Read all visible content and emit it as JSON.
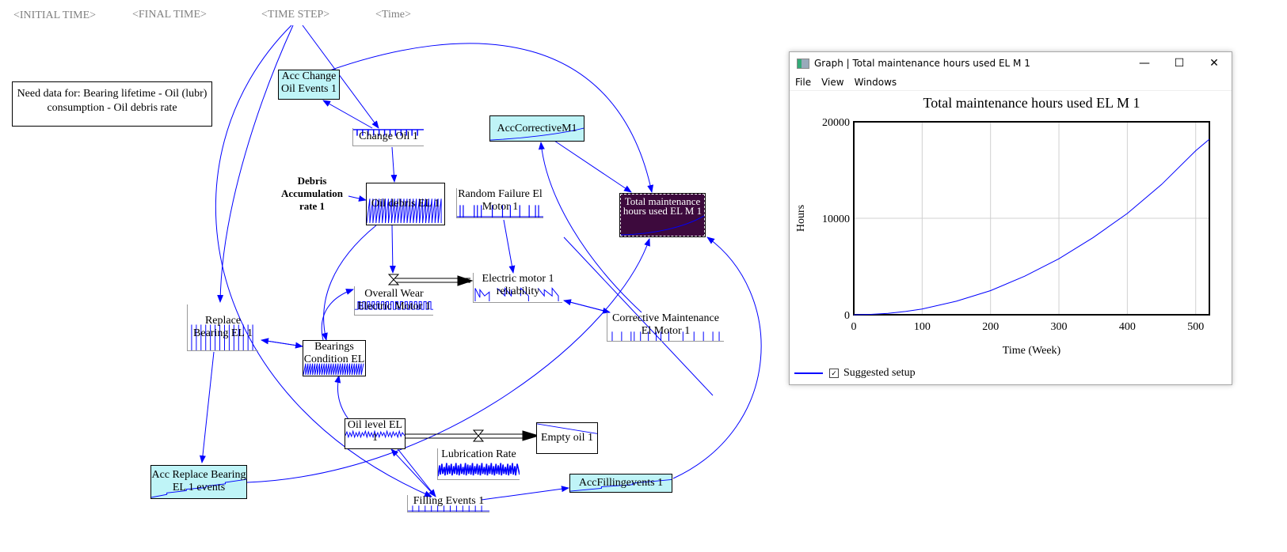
{
  "diagram": {
    "shadow_variables": [
      "<INITIAL TIME>",
      "<FINAL TIME>",
      "<TIME STEP>",
      "<Time>"
    ],
    "note": "Need data for: Bearing lifetime - Oil (lubr) consumption - Oil debris rate",
    "variables": {
      "acc_change_oil_events": "Acc Change Oil Events 1",
      "change_oil": "Change Oil 1",
      "debris_accumulation_rate": "Debris Accumulation rate 1",
      "oil_debris": "Oil debris EL 1",
      "random_failure": "Random Failure El Motor 1",
      "acc_corrective": "AccCorrectiveM1",
      "total_maintenance_hours": "Total maintenance hours used EL M 1",
      "overall_wear": "Overall Wear Electric Motor 1",
      "electric_motor_reliability": "Electric motor 1 reliability",
      "corrective_maintenance": "Corrective Maintenance El Motor 1",
      "replace_bearing": "Replace Bearing EL 1",
      "bearings_condition": "Bearings Condition EL",
      "oil_level": "Oil level EL 1",
      "lubrication_rate": "Lubrication Rate",
      "empty_oil": "Empty oil 1",
      "acc_replace_bearing_events": "Acc Replace Bearing EL 1 events",
      "filling_events": "Filling Events 1",
      "acc_filling_events": "AccFillingevents 1"
    },
    "colors": {
      "link": "#0000ff",
      "stock_cyan": "#bff4f7",
      "selected": "#3d0a3d"
    }
  },
  "graph_window": {
    "title": "Graph | Total maintenance hours used EL M 1",
    "menu": [
      "File",
      "View",
      "Windows"
    ],
    "buttons": {
      "minimize": "—",
      "maximize": "☐",
      "close": "✕"
    },
    "legend": {
      "label": "Suggested setup",
      "checked": true,
      "checkbox_glyph": "✓"
    }
  },
  "chart_data": {
    "type": "line",
    "title": "Total maintenance hours used EL M 1",
    "xlabel": "Time (Week)",
    "ylabel": "Hours",
    "xlim": [
      0,
      520
    ],
    "ylim": [
      0,
      20000
    ],
    "x_ticks": [
      0,
      100,
      200,
      300,
      400,
      500
    ],
    "y_ticks": [
      0,
      10000,
      20000
    ],
    "grid": true,
    "legend_position": "bottom-left",
    "series": [
      {
        "name": "Suggested setup",
        "color": "#0000ff",
        "x": [
          0,
          25,
          50,
          75,
          100,
          150,
          200,
          250,
          300,
          350,
          400,
          450,
          500,
          520
        ],
        "values": [
          0,
          40,
          150,
          340,
          600,
          1400,
          2500,
          4000,
          5800,
          8000,
          10500,
          13500,
          17000,
          18200
        ]
      }
    ]
  }
}
